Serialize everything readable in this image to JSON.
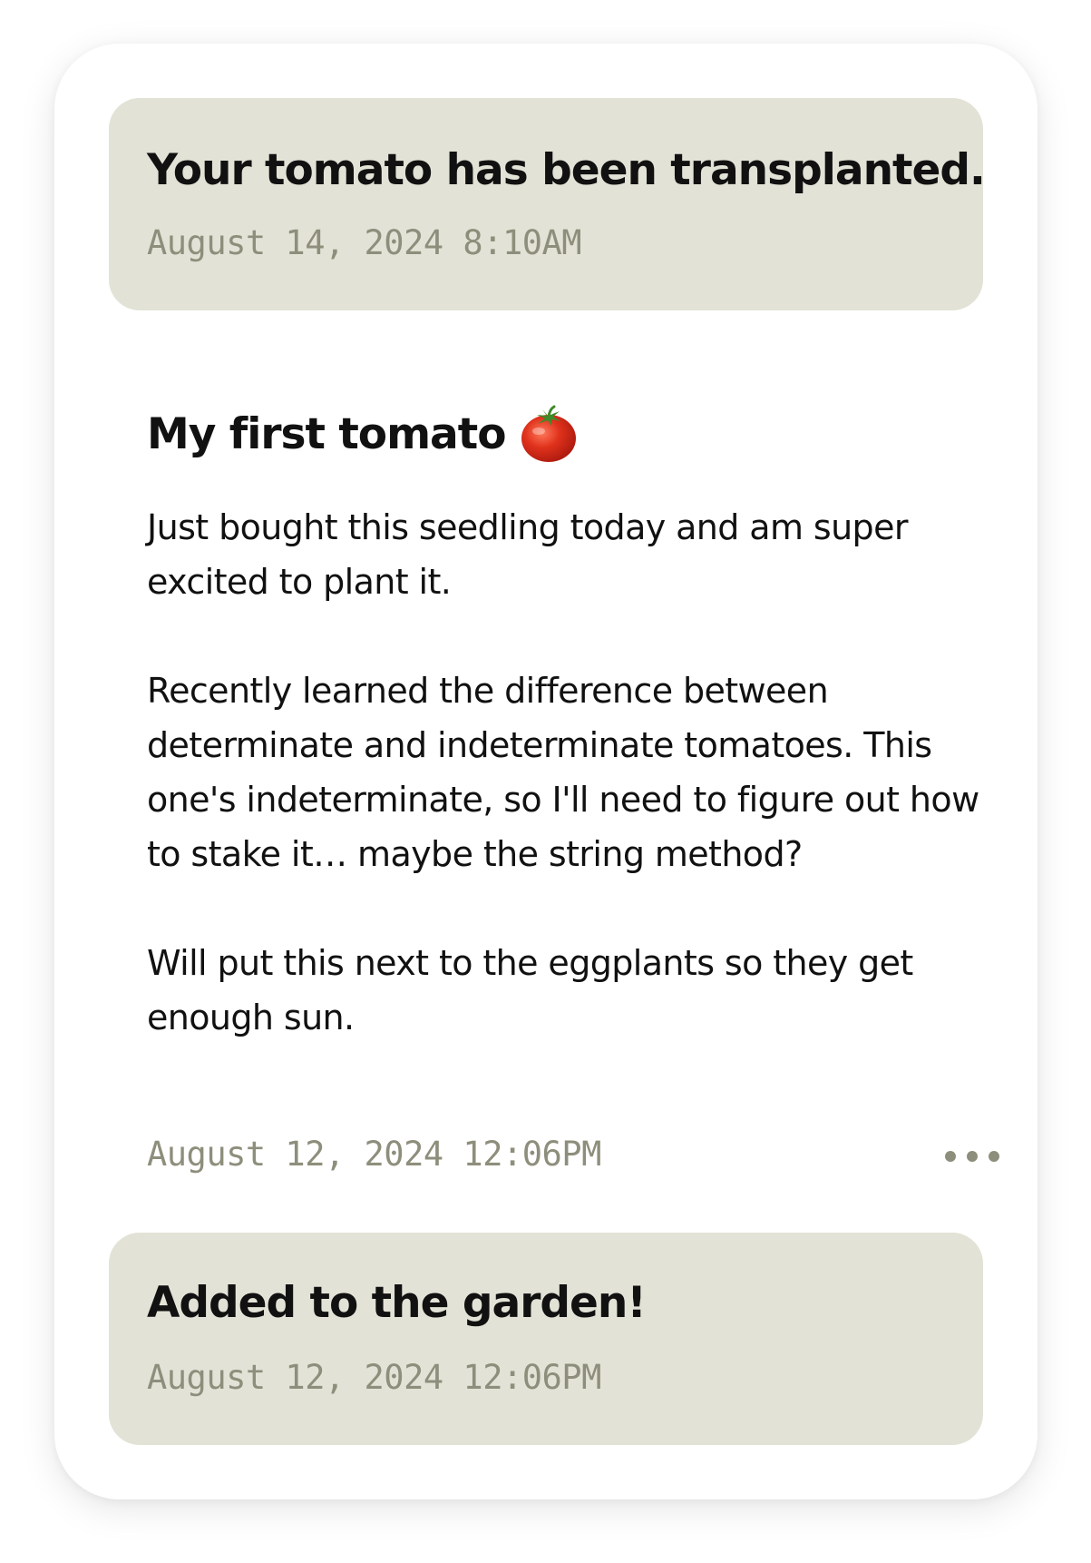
{
  "events": [
    {
      "title": "Your tomato has been transplanted.",
      "timestamp": "August 14, 2024 8:10AM"
    },
    {
      "title": "Added to the garden!",
      "timestamp": "August 12, 2024 12:06PM"
    }
  ],
  "note": {
    "title": "My first tomato",
    "emoji_icon": "tomato-icon",
    "paragraphs": [
      "Just bought this seedling today and am super excited to plant it.",
      "Recently learned the difference between determinate and indeterminate tomatoes. This one's indeterminate, so I'll need to figure out how to stake it… maybe the string method?",
      "Will put this next to the eggplants so they get enough sun."
    ],
    "timestamp": "August 12, 2024 12:06PM",
    "more_icon": "more-horizontal-icon"
  },
  "colors": {
    "event_background": "#e3e2d6",
    "muted_text": "#8e8e7c",
    "primary_text": "#111111",
    "card_background": "#ffffff"
  }
}
